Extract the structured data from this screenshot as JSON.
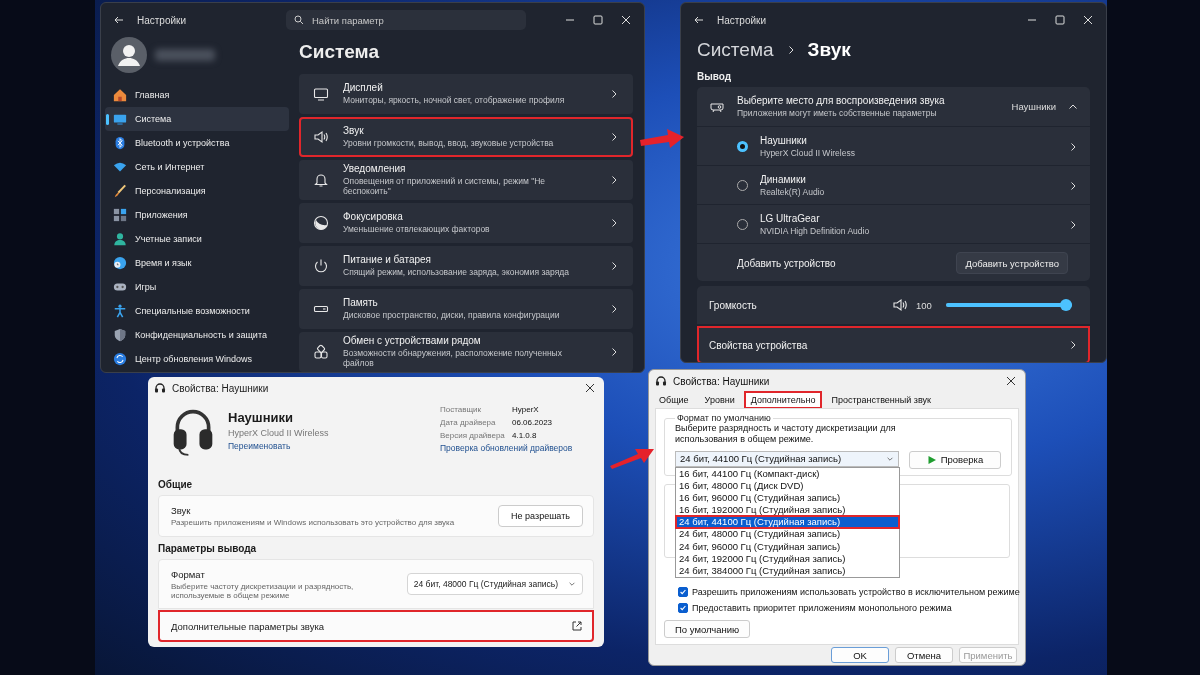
{
  "settings_window": {
    "title": "Настройки",
    "search": {
      "placeholder": "Найти параметр"
    },
    "page_title": "Система",
    "nav": [
      {
        "label": "Главная",
        "kind": "home",
        "selected": false
      },
      {
        "label": "Система",
        "kind": "system",
        "selected": true
      },
      {
        "label": "Bluetooth и устройства",
        "kind": "bluetooth",
        "selected": false
      },
      {
        "label": "Сеть и Интернет",
        "kind": "network",
        "selected": false
      },
      {
        "label": "Персонализация",
        "kind": "personalization",
        "selected": false
      },
      {
        "label": "Приложения",
        "kind": "apps",
        "selected": false
      },
      {
        "label": "Учетные записи",
        "kind": "accounts",
        "selected": false
      },
      {
        "label": "Время и язык",
        "kind": "time",
        "selected": false
      },
      {
        "label": "Игры",
        "kind": "games",
        "selected": false
      },
      {
        "label": "Специальные возможности",
        "kind": "accessibility",
        "selected": false
      },
      {
        "label": "Конфиденциальность и защита",
        "kind": "privacy",
        "selected": false
      },
      {
        "label": "Центр обновления Windows",
        "kind": "update",
        "selected": false
      }
    ],
    "items": [
      {
        "title": "Дисплей",
        "subtitle": "Мониторы, яркость, ночной свет, отображение профиля",
        "kind": "display",
        "highlighted": false
      },
      {
        "title": "Звук",
        "subtitle": "Уровни громкости, вывод, ввод, звуковые устройства",
        "kind": "sound",
        "highlighted": true
      },
      {
        "title": "Уведомления",
        "subtitle": "Оповещения от приложений и системы, режим \"Не беспокоить\"",
        "kind": "notifications",
        "highlighted": false
      },
      {
        "title": "Фокусировка",
        "subtitle": "Уменьшение отвлекающих факторов",
        "kind": "focus",
        "highlighted": false
      },
      {
        "title": "Питание и батарея",
        "subtitle": "Спящий режим, использование заряда, экономия заряда",
        "kind": "power",
        "highlighted": false
      },
      {
        "title": "Память",
        "subtitle": "Дисковое пространство, диски, правила конфигурации",
        "kind": "storage",
        "highlighted": false
      },
      {
        "title": "Обмен с устройствами рядом",
        "subtitle": "Возможности обнаружения, расположение полученных файлов",
        "kind": "nearby",
        "highlighted": false
      }
    ]
  },
  "sound_window": {
    "title": "Настройки",
    "breadcrumb": [
      "Система",
      "Звук"
    ],
    "section": "Вывод",
    "output_selector": {
      "title": "Выберите место для воспроизведения звука",
      "subtitle": "Приложения могут иметь собственные параметры",
      "value": "Наушники",
      "expanded": true
    },
    "devices": [
      {
        "name": "Наушники",
        "driver": "HyperX Cloud II Wireless",
        "selected": true
      },
      {
        "name": "Динамики",
        "driver": "Realtek(R) Audio",
        "selected": false
      },
      {
        "name": "LG UltraGear",
        "driver": "NVIDIA High Definition Audio",
        "selected": false
      }
    ],
    "add_device": {
      "label": "Добавить устройство",
      "button": "Добавить устройство"
    },
    "volume": {
      "label": "Громкость",
      "reading": "100",
      "level": 1
    },
    "device_properties": {
      "label": "Свойства устройства",
      "highlighted": true
    }
  },
  "properties_window": {
    "title": "Свойства: Наушники",
    "device_name": "Наушники",
    "device_model": "HyperX Cloud II Wireless",
    "rename_link": "Переименовать",
    "info": [
      {
        "label": "Поставщик",
        "value": "HyperX"
      },
      {
        "label": "Дата драйвера",
        "value": "06.06.2023"
      },
      {
        "label": "Версия драйвера",
        "value": "4.1.0.8"
      }
    ],
    "driver_update_link": "Проверка обновлений драйверов",
    "general_heading": "Общие",
    "sound": {
      "title": "Звук",
      "subtitle": "Разрешить приложениям и Windows использовать это устройство для звука",
      "button": "Не разрешать"
    },
    "output_heading": "Параметры вывода",
    "format": {
      "title": "Формат",
      "subtitle": "Выберите частоту дискретизации и разрядность, используемые в общем режиме",
      "value": "24 бит, 48000 Гц (Студийная запись)"
    },
    "advanced": {
      "label": "Дополнительные параметры звука",
      "highlighted": true
    }
  },
  "classic_dialog": {
    "title": "Свойства: Наушники",
    "tabs": [
      {
        "label": "Общие",
        "selected": false,
        "highlighted": false
      },
      {
        "label": "Уровни",
        "selected": false,
        "highlighted": false
      },
      {
        "label": "Дополнительно",
        "selected": true,
        "highlighted": true
      },
      {
        "label": "Пространственный звук",
        "selected": false,
        "highlighted": false
      }
    ],
    "group_title": "Формат по умолчанию",
    "description": "Выберите разрядность и частоту дискретизации для использования в общем режиме.",
    "format_value": "24 бит, 44100 Гц (Студийная запись)",
    "test_button": "Проверка",
    "options": [
      {
        "label": "16 бит, 44100 Гц (Компакт-диск)",
        "selected": false,
        "highlighted": false
      },
      {
        "label": "16 бит, 48000 Гц (Диск DVD)",
        "selected": false,
        "highlighted": false
      },
      {
        "label": "16 бит, 96000 Гц (Студийная запись)",
        "selected": false,
        "highlighted": false
      },
      {
        "label": "16 бит, 192000 Гц (Студийная запись)",
        "selected": false,
        "highlighted": false
      },
      {
        "label": "24 бит, 44100 Гц (Студийная запись)",
        "selected": true,
        "highlighted": true
      },
      {
        "label": "24 бит, 48000 Гц (Студийная запись)",
        "selected": false,
        "highlighted": false
      },
      {
        "label": "24 бит, 96000 Гц (Студийная запись)",
        "selected": false,
        "highlighted": false
      },
      {
        "label": "24 бит, 192000 Гц (Студийная запись)",
        "selected": false,
        "highlighted": false
      },
      {
        "label": "24 бит, 384000 Гц (Студийная запись)",
        "selected": false,
        "highlighted": false
      }
    ],
    "checkboxes": [
      {
        "label": "Разрешить приложениям использовать устройство в исключительном режиме",
        "checked": true
      },
      {
        "label": "Предоставить приоритет приложениям монопольного режима",
        "checked": true
      }
    ],
    "defaults_button": "По умолчанию",
    "buttons": [
      {
        "label": "OK",
        "disabled": false
      },
      {
        "label": "Отмена",
        "disabled": false
      },
      {
        "label": "Применить",
        "disabled": true
      }
    ]
  }
}
